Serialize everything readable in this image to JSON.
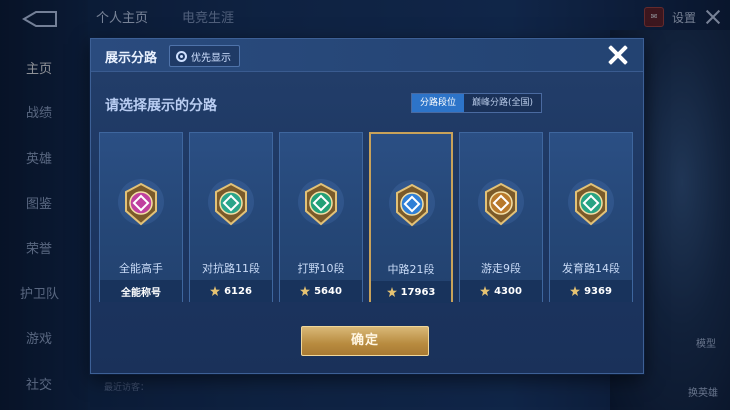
{
  "background": {
    "tabs": [
      "个人主页",
      "电竞生涯"
    ],
    "nav": [
      "主页",
      "战绩",
      "英雄",
      "图鉴",
      "荣誉",
      "护卫队",
      "游戏",
      "社交"
    ],
    "settings_label": "设置",
    "bottom_hint": "最近访客：",
    "right_labels": [
      "模型",
      "换英雄"
    ]
  },
  "dialog": {
    "title": "展示分路",
    "priority_label": "优先显示",
    "subtitle": "请选择展示的分路",
    "segments": [
      "分路段位",
      "巅峰分路(全国)"
    ],
    "confirm_label": "确定"
  },
  "cards": [
    {
      "name": "全能高手",
      "foot": "全能称号",
      "has_star": false,
      "badge_color": "#c0409f",
      "selected": false
    },
    {
      "name": "对抗路11段",
      "foot": "6126",
      "has_star": true,
      "badge_color": "#2aa58a",
      "selected": false
    },
    {
      "name": "打野10段",
      "foot": "5640",
      "has_star": true,
      "badge_color": "#22a077",
      "selected": false
    },
    {
      "name": "中路21段",
      "foot": "17963",
      "has_star": true,
      "badge_color": "#2f7fd6",
      "selected": true
    },
    {
      "name": "游走9段",
      "foot": "4300",
      "has_star": true,
      "badge_color": "#b8792b",
      "selected": false
    },
    {
      "name": "发育路14段",
      "foot": "9369",
      "has_star": true,
      "badge_color": "#27a383",
      "selected": false
    }
  ],
  "colors": {
    "accent_gold": "#c8a25a",
    "segment_active": "#2d74c9"
  }
}
